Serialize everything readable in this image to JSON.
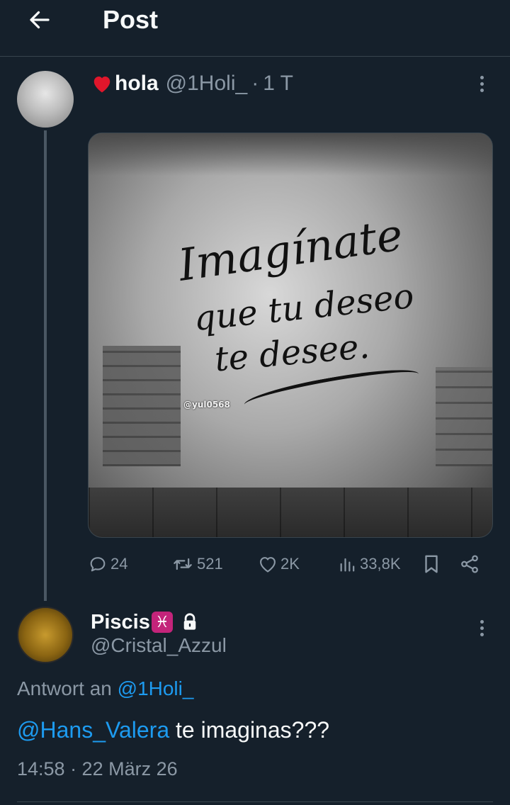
{
  "header": {
    "title": "Post"
  },
  "post": {
    "name": "hola",
    "handle": "@1Holi_",
    "separator": "·",
    "time": "1 T",
    "image_text": {
      "line1": "Imagínate",
      "line2": "que tu deseo",
      "line3": "te desee.",
      "watermark": "@yul0568"
    },
    "actions": {
      "replies": "24",
      "reposts": "521",
      "likes": "2K",
      "views": "33,8K"
    },
    "icons": [
      "heart-emoji-icon",
      "more-icon",
      "reply-icon",
      "repost-icon",
      "like-icon",
      "views-icon",
      "bookmark-icon",
      "share-icon"
    ]
  },
  "reply": {
    "name": "Piscis",
    "badge": "♓",
    "handle": "@Cristal_Azzul",
    "reply_prefix": "Antwort an",
    "reply_to": "@1Holi_",
    "mention": "@Hans_Valera",
    "text": " te imaginas???",
    "timestamp": "14:58 · 22 März 26",
    "icons": [
      "lock-icon",
      "more-icon"
    ]
  },
  "colors": {
    "background": "#15202b",
    "text": "#f7f9f9",
    "secondary": "#8b98a5",
    "link": "#1d9bf0",
    "divider": "#38444d",
    "heart": "#f91880",
    "badge": "#c3247a"
  }
}
